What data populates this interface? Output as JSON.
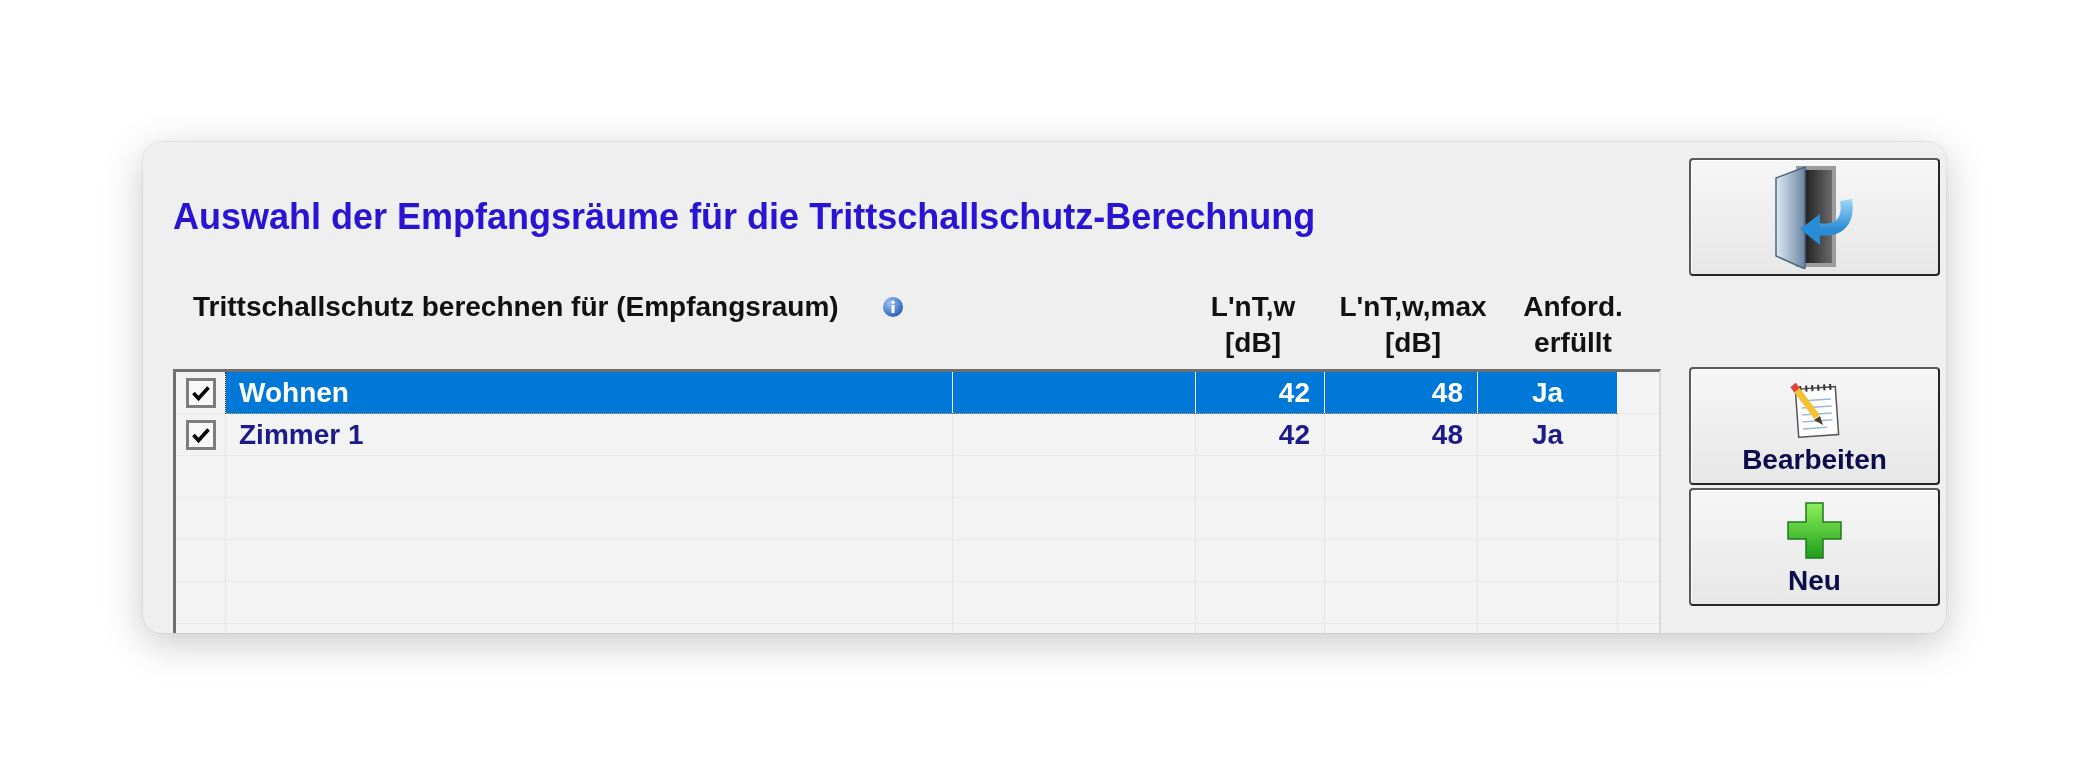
{
  "window": {
    "title": "Auswahl der Empfangsräume für die Trittschallschutz-Berechnung"
  },
  "table": {
    "columns": [
      {
        "kind": "room",
        "lines": [
          "Trittschallschutz berechnen für (Empfangsraum)"
        ],
        "info": true
      },
      {
        "kind": "value",
        "lines": [
          "L'nT,w",
          "[dB]"
        ]
      },
      {
        "kind": "value",
        "lines": [
          "L'nT,w,max",
          "[dB]"
        ]
      },
      {
        "kind": "status",
        "lines": [
          "Anford.",
          "erfüllt"
        ]
      }
    ],
    "rows": [
      {
        "checked": true,
        "selected": true,
        "cells": [
          "Wohnen",
          "42",
          "48",
          "Ja"
        ]
      },
      {
        "checked": true,
        "selected": false,
        "cells": [
          "Zimmer 1",
          "42",
          "48",
          "Ja"
        ]
      }
    ]
  },
  "buttons": [
    {
      "kind": "exit"
    },
    {
      "kind": "edit",
      "label": "Bearbeiten"
    },
    {
      "kind": "new",
      "label": "Neu"
    }
  ]
}
